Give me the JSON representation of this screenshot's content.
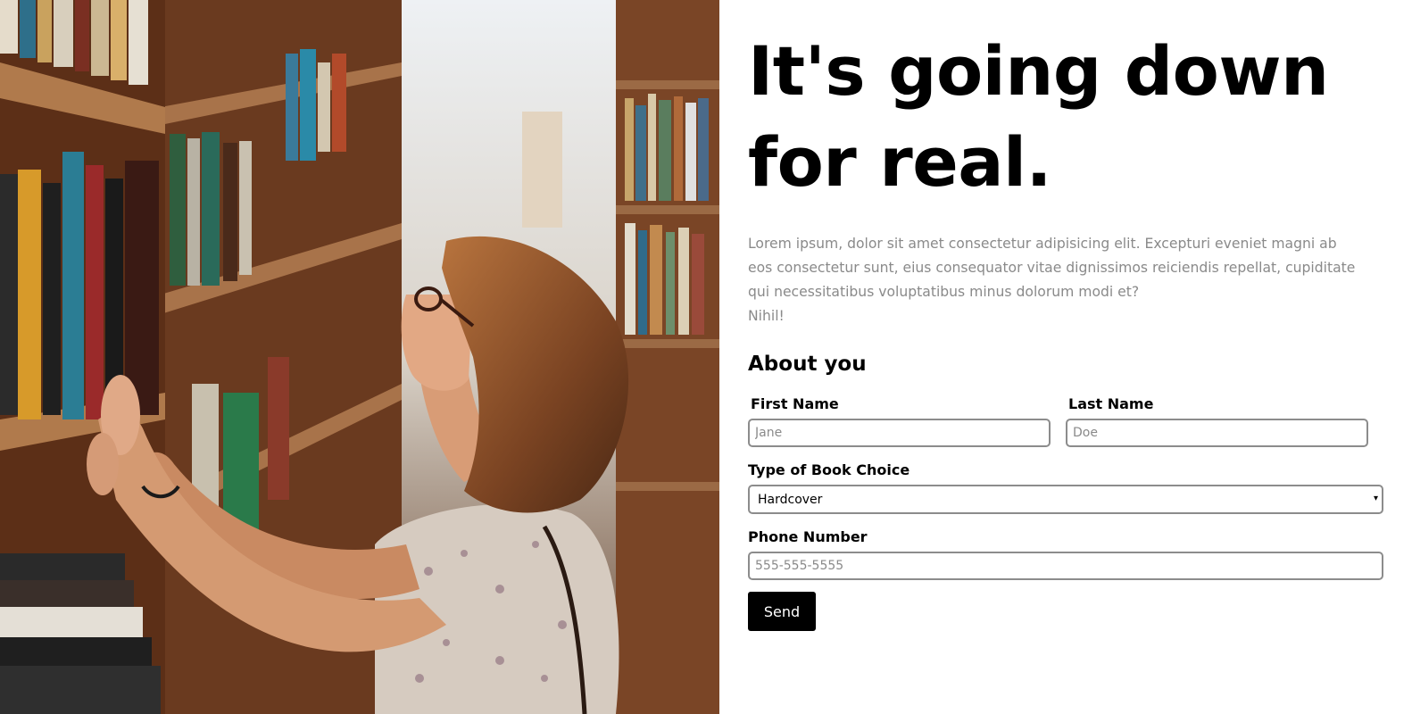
{
  "hero": {
    "image_alt": "woman browsing books in a library aisle",
    "headline": "It's going down for real.",
    "intro": "Lorem ipsum, dolor sit amet consectetur adipisicing elit. Excepturi eveniet magni ab eos consectetur sunt, eius consequator vitae dignissimos reiciendis repellat, cupiditate qui necessitatibus voluptatibus minus dolorum modi et?",
    "intro_tail": "Nihil!"
  },
  "form": {
    "section_title": "About you",
    "first_name": {
      "label": "First Name",
      "placeholder": "Jane",
      "value": ""
    },
    "last_name": {
      "label": "Last Name",
      "placeholder": "Doe",
      "value": ""
    },
    "book_type": {
      "label": "Type of Book Choice",
      "selected": "Hardcover",
      "caret": "▾"
    },
    "phone": {
      "label": "Phone Number",
      "placeholder": "555-555-5555",
      "value": ""
    },
    "submit_label": "Send"
  },
  "colors": {
    "text": "#000000",
    "muted_text": "#8a8a8a",
    "input_border": "#8c8c8c",
    "button_bg": "#000000",
    "button_text": "#ffffff"
  }
}
